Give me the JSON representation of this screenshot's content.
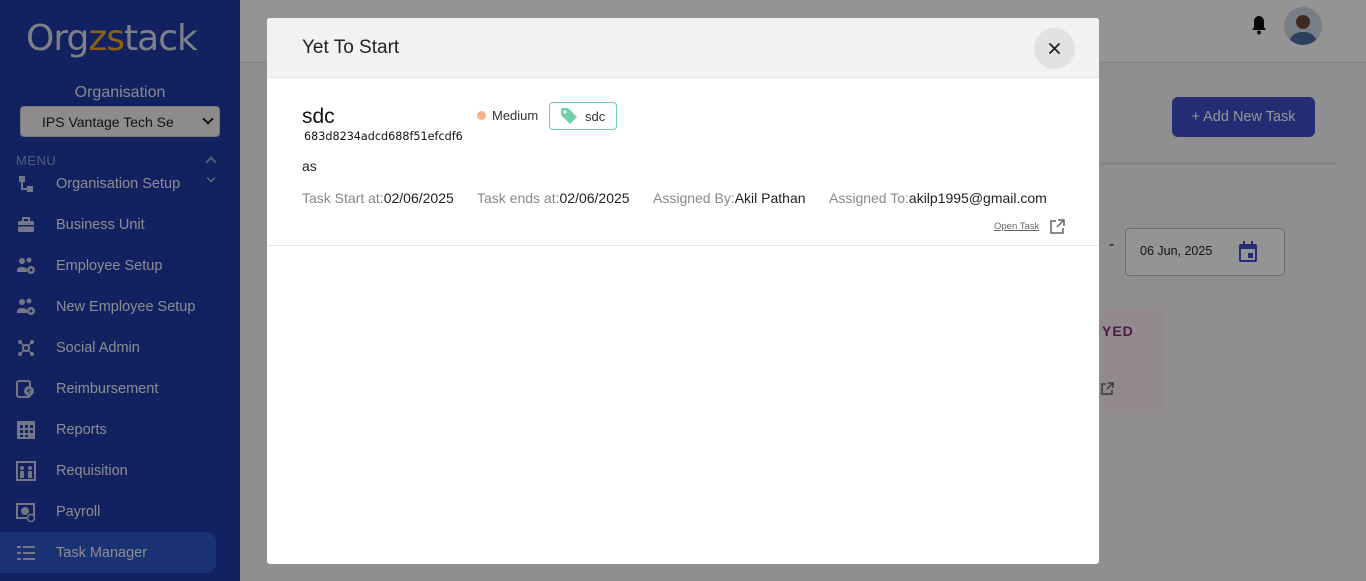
{
  "app": {
    "logo_prefix": "Org",
    "logo_accent": "zs",
    "logo_suffix": "tack"
  },
  "sidebar": {
    "organisation_label": "Organisation",
    "organisation_value": "IPS Vantage Tech Se",
    "menu_label": "MENU",
    "items": [
      {
        "label": "Organisation Setup",
        "icon": "org-setup-icon"
      },
      {
        "label": "Business Unit",
        "icon": "briefcase-icon"
      },
      {
        "label": "Employee Setup",
        "icon": "users-gear-icon"
      },
      {
        "label": "New Employee Setup",
        "icon": "users-gear-icon"
      },
      {
        "label": "Social Admin",
        "icon": "social-icon"
      },
      {
        "label": "Reimbursement",
        "icon": "reimbursement-icon"
      },
      {
        "label": "Reports",
        "icon": "reports-icon"
      },
      {
        "label": "Requisition",
        "icon": "requisition-icon"
      },
      {
        "label": "Payroll",
        "icon": "payroll-icon"
      },
      {
        "label": "Task Manager",
        "icon": "task-list-icon",
        "active": true
      }
    ]
  },
  "page": {
    "add_task_label": "+ Add New Task",
    "date_value": "06 Jun, 2025",
    "date_separator": "-",
    "card_partial_text": "YED"
  },
  "modal": {
    "title": "Yet To Start",
    "task": {
      "name": "sdc",
      "id": "683d8234adcd688f51efcdf6",
      "priority": "Medium",
      "tag": "sdc",
      "description": "as",
      "start_label": "Task Start at:",
      "start_value": "02/06/2025",
      "end_label": "Task ends at:",
      "end_value": "02/06/2025",
      "assigned_by_label": "Assigned By:",
      "assigned_by_value": "Akil Pathan",
      "assigned_to_label": "Assigned To:",
      "assigned_to_value": "akilp1995@gmail.com",
      "open_task_label": "Open Task"
    }
  },
  "colors": {
    "sidebar": "#1f3aa6",
    "active_item": "#2e56c9",
    "primary_button": "#3f4ec9",
    "priority_medium": "#f6b48a",
    "tag_border": "#6fd2ad"
  }
}
